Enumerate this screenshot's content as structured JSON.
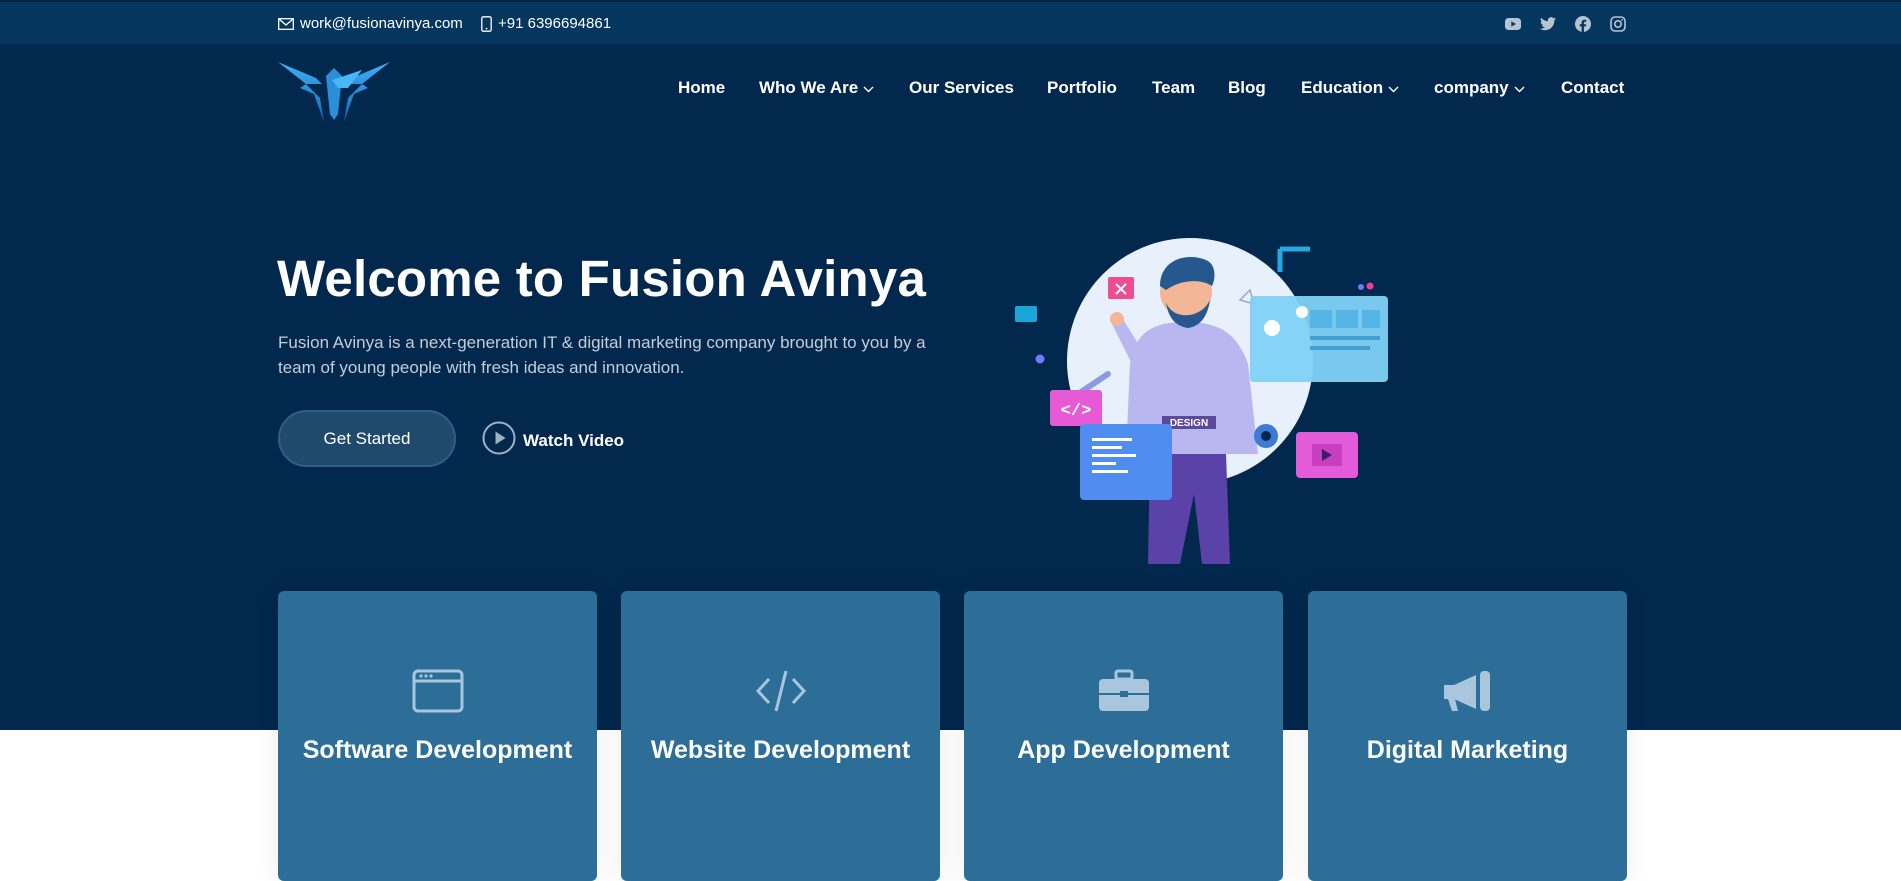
{
  "colors": {
    "topbar_bg": "#04365e",
    "hero_bg": "#03284d",
    "card_bg": "#2c6e98",
    "accent": "#1f4a6c"
  },
  "topbar": {
    "email": "work@fusionavinya.com",
    "phone": "+91 6396694861",
    "social": [
      {
        "icon": "youtube-icon"
      },
      {
        "icon": "twitter-icon"
      },
      {
        "icon": "facebook-icon"
      },
      {
        "icon": "instagram-icon"
      }
    ]
  },
  "nav": {
    "items": [
      {
        "label": "Home"
      },
      {
        "label": "Who We Are",
        "dropdown": true
      },
      {
        "label": "Our Services"
      },
      {
        "label": "Portfolio"
      },
      {
        "label": "Team"
      },
      {
        "label": "Blog"
      },
      {
        "label": "Education",
        "dropdown": true
      },
      {
        "label": "company",
        "dropdown": true
      },
      {
        "label": "Contact"
      }
    ]
  },
  "hero": {
    "title": "Welcome to Fusion Avinya",
    "description": "Fusion Avinya is a next-generation IT & digital marketing company brought to you by a team of young people with fresh ideas and innovation.",
    "primary_button": "Get Started",
    "secondary_button": "Watch Video",
    "illustration_label": "DESIGN"
  },
  "services": [
    {
      "icon": "browser-window-icon",
      "title": "Software Development"
    },
    {
      "icon": "code-icon",
      "title": "Website Development"
    },
    {
      "icon": "briefcase-icon",
      "title": "App Development"
    },
    {
      "icon": "megaphone-icon",
      "title": "Digital Marketing"
    }
  ]
}
